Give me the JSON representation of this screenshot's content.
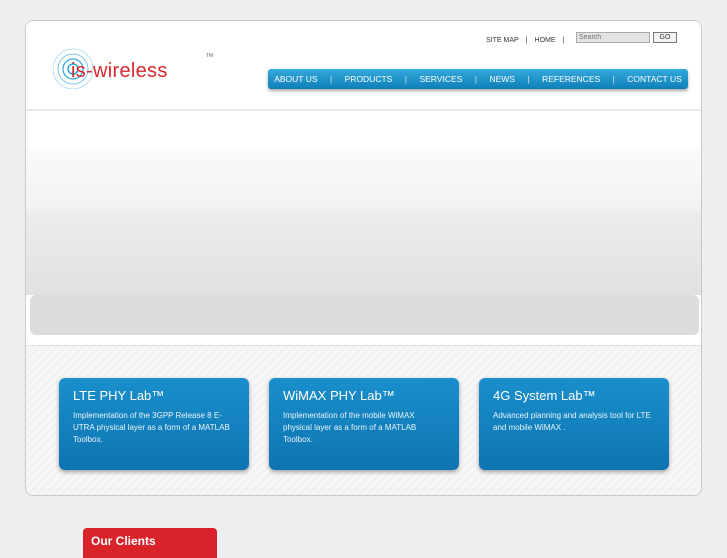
{
  "brand": {
    "name": "is-wireless",
    "tm": "TM",
    "color": "#d9282f"
  },
  "toplinks": {
    "site_map": "SITE MAP",
    "home": "HOME",
    "separator": "|"
  },
  "search": {
    "placeholder": "Search",
    "go_label": "GO"
  },
  "nav": {
    "items": [
      {
        "label": "ABOUT US"
      },
      {
        "label": "PRODUCTS"
      },
      {
        "label": "SERVICES"
      },
      {
        "label": "NEWS"
      },
      {
        "label": "REFERENCES"
      },
      {
        "label": "CONTACT US"
      }
    ],
    "separator": "|",
    "accent": "#1a8fcc"
  },
  "cards": [
    {
      "title": "LTE PHY Lab™",
      "text": "Implementation of the 3GPP Release 8 E-UTRA physical layer as a form of a MATLAB Toolbox."
    },
    {
      "title": "WiMAX PHY Lab™",
      "text": "Implementation of the mobile WiMAX physical layer as a form of a MATLAB Toolbox."
    },
    {
      "title": "4G System Lab™",
      "text": "Advanced planning and analysis tool for LTE and mobile WiMAX ."
    }
  ],
  "clients": {
    "label": "Our Clients",
    "color": "#d9222a"
  }
}
